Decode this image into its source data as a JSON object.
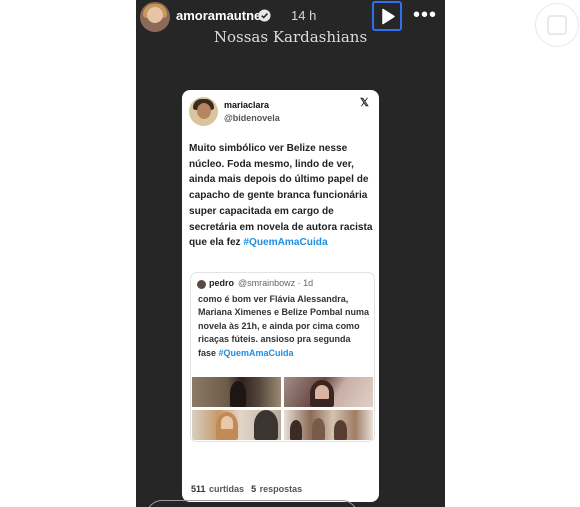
{
  "story": {
    "username": "amoramautner",
    "time_ago": "14 h",
    "caption": "Nossas Kardashians",
    "icons": [
      "avatar",
      "verified-badge-icon",
      "play-icon",
      "more-options-icon"
    ]
  },
  "tweet": {
    "name": "mariaclara",
    "handle": "@bidenovela",
    "logo": "x-logo-icon",
    "text": "Muito simbólico ver Belize nesse núcleo. Foda mesmo, lindo de ver, ainda mais depois do último papel de capacho de gente branca funcionária super capacitada em cargo de secretária em novela de autora racista que ela fez",
    "hashtag": "#QuemAmaCuida",
    "quoted": {
      "name": "pedro",
      "handle": "@smrainbowz",
      "time": "1d",
      "text": "como é bom ver Flávia Alessandra, Mariana Ximenes e Belize Pombal numa novela às 21h, e ainda por cima como ricaças fúteis. ansioso pra segunda fase",
      "hashtag": "#QuemAmaCuida"
    },
    "likes_count": "511",
    "likes_label": "curtidas",
    "replies_count": "5",
    "replies_label": "respostas"
  },
  "colors": {
    "story_background": "#262626",
    "hashtag": "#1d8fe0",
    "focus_outline": "#2f6ff0"
  }
}
